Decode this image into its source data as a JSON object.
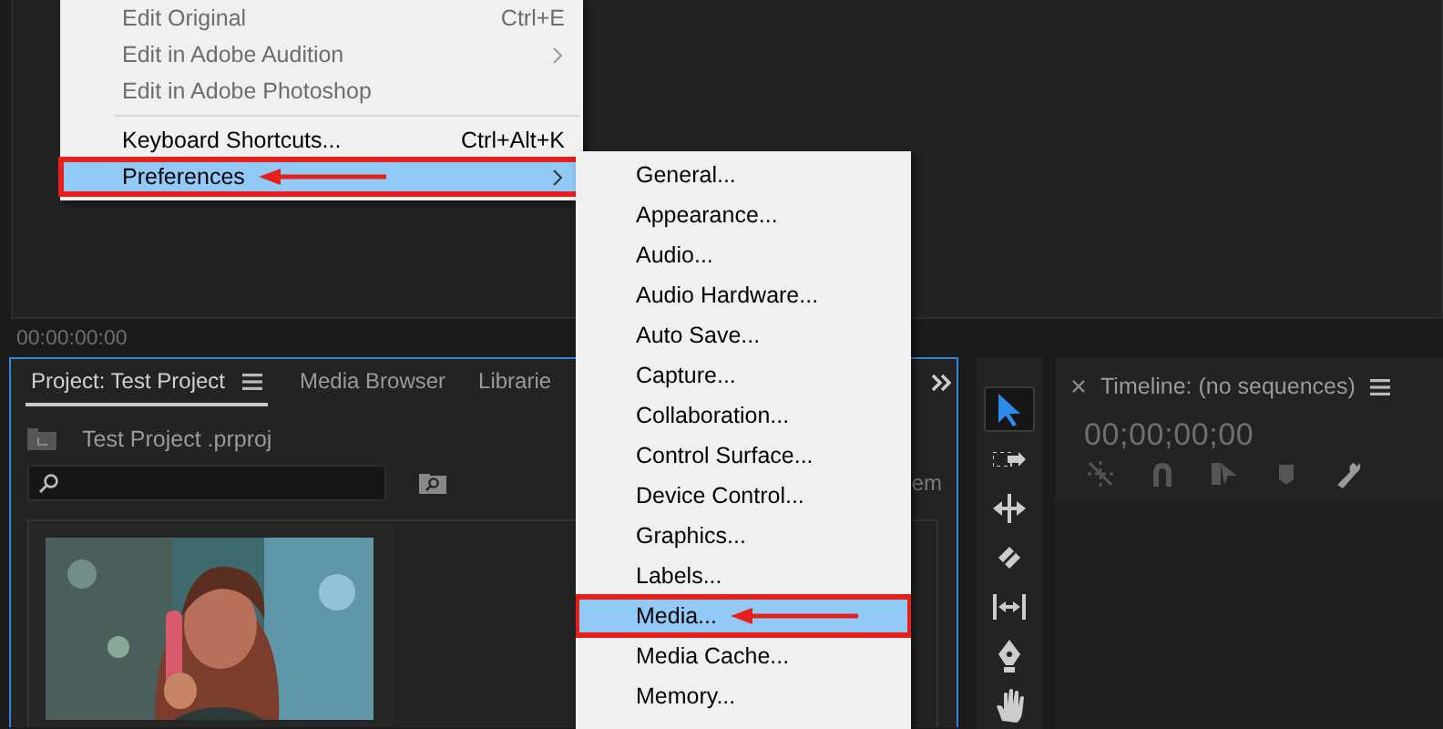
{
  "monitor": {
    "timecode": "00:00:00:00"
  },
  "context_menu": {
    "items": [
      {
        "kind": "item",
        "label": "Edit Original",
        "shortcut": "Ctrl+E",
        "disabled": true,
        "submenu": false,
        "selected": false,
        "callout": false
      },
      {
        "kind": "item",
        "label": "Edit in Adobe Audition",
        "disabled": true,
        "submenu": true,
        "selected": false,
        "callout": false
      },
      {
        "kind": "item",
        "label": "Edit in Adobe Photoshop",
        "disabled": true,
        "submenu": false,
        "selected": false,
        "callout": false
      },
      {
        "kind": "separator"
      },
      {
        "kind": "item",
        "label": "Keyboard Shortcuts...",
        "shortcut": "Ctrl+Alt+K",
        "disabled": false,
        "submenu": false,
        "selected": false,
        "callout": false
      },
      {
        "kind": "item",
        "label": "Preferences",
        "disabled": false,
        "submenu": true,
        "selected": true,
        "callout": true
      }
    ]
  },
  "submenu": {
    "items": [
      {
        "label": "General...",
        "selected": false,
        "callout": false
      },
      {
        "label": "Appearance...",
        "selected": false,
        "callout": false
      },
      {
        "label": "Audio...",
        "selected": false,
        "callout": false
      },
      {
        "label": "Audio Hardware...",
        "selected": false,
        "callout": false
      },
      {
        "label": "Auto Save...",
        "selected": false,
        "callout": false
      },
      {
        "label": "Capture...",
        "selected": false,
        "callout": false
      },
      {
        "label": "Collaboration...",
        "selected": false,
        "callout": false
      },
      {
        "label": "Control Surface...",
        "selected": false,
        "callout": false
      },
      {
        "label": "Device Control...",
        "selected": false,
        "callout": false
      },
      {
        "label": "Graphics...",
        "selected": false,
        "callout": false
      },
      {
        "label": "Labels...",
        "selected": false,
        "callout": false
      },
      {
        "label": "Media...",
        "selected": true,
        "callout": true
      },
      {
        "label": "Media Cache...",
        "selected": false,
        "callout": false
      },
      {
        "label": "Memory...",
        "selected": false,
        "callout": false
      }
    ]
  },
  "project_panel": {
    "tabs": [
      {
        "label": "Project: Test Project",
        "selected": true
      },
      {
        "label": "Media Browser",
        "selected": false
      },
      {
        "label": "Librarie",
        "selected": false
      }
    ],
    "bin_path": "Test Project .prproj",
    "item_count": "em"
  },
  "tools": [
    {
      "kind": "selection",
      "selected": true
    },
    {
      "kind": "track-select",
      "selected": false
    },
    {
      "kind": "ripple",
      "selected": false
    },
    {
      "kind": "razor",
      "selected": false
    },
    {
      "kind": "slip",
      "selected": false
    },
    {
      "kind": "pen",
      "selected": false
    },
    {
      "kind": "hand",
      "selected": false
    }
  ],
  "timeline": {
    "title": "Timeline: (no sequences)",
    "timecode": "00;00;00;00"
  }
}
